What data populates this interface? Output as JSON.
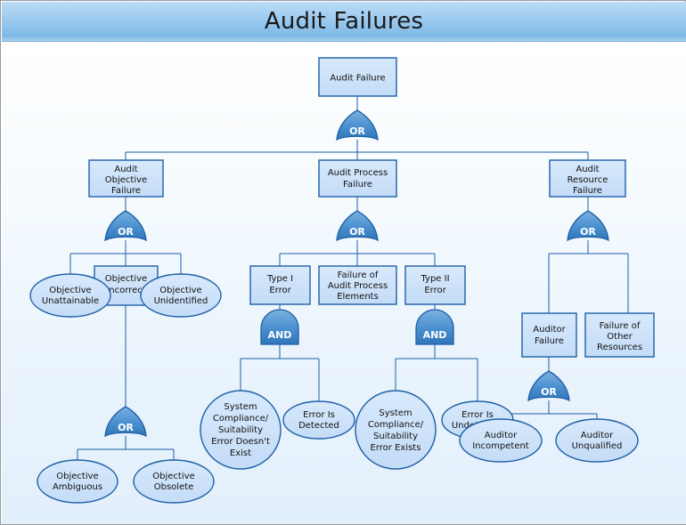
{
  "window": {
    "title": "Audit Failures"
  },
  "colors": {
    "title_bar_top": "#bcdcf6",
    "title_bar_bottom": "#7fb9e6",
    "canvas_top": "#ffffff",
    "canvas_bottom": "#e2f0fb",
    "node_fill": "#cfe4fa",
    "node_stroke": "#1f5fa8",
    "gate_fill_top": "#6fa9dd",
    "gate_fill_bottom": "#2f77b8",
    "gate_stroke": "#1f5fa8",
    "connector": "#1f5fa8",
    "text": "#111111",
    "gate_text": "#ffffff"
  },
  "diagram": {
    "type": "fault-tree",
    "nodes": [
      {
        "id": "audit-failure",
        "shape": "rect",
        "label": "Audit Failure",
        "lines": [
          "Audit Failure"
        ]
      },
      {
        "id": "audit-objective-failure",
        "shape": "rect",
        "label": "Audit Objective Failure",
        "lines": [
          "Audit",
          "Objective",
          "Failure"
        ]
      },
      {
        "id": "audit-process-failure",
        "shape": "rect",
        "label": "Audit Process Failure",
        "lines": [
          "Audit Process",
          "Failure"
        ]
      },
      {
        "id": "audit-resource-failure",
        "shape": "rect",
        "label": "Audit Resource Failure",
        "lines": [
          "Audit",
          "Resource",
          "Failure"
        ]
      },
      {
        "id": "objective-incorrect",
        "shape": "rect",
        "label": "Objective Incorrect",
        "lines": [
          "Objective",
          "Incorrect"
        ]
      },
      {
        "id": "objective-unattainable",
        "shape": "ellipse",
        "label": "Objective Unattainable",
        "lines": [
          "Objective",
          "Unattainable"
        ]
      },
      {
        "id": "objective-unidentified",
        "shape": "ellipse",
        "label": "Objective Unidentified",
        "lines": [
          "Objective",
          "Unidentified"
        ]
      },
      {
        "id": "objective-ambiguous",
        "shape": "ellipse",
        "label": "Objective Ambiguous",
        "lines": [
          "Objective",
          "Ambiguous"
        ]
      },
      {
        "id": "objective-obsolete",
        "shape": "ellipse",
        "label": "Objective Obsolete",
        "lines": [
          "Objective",
          "Obsolete"
        ]
      },
      {
        "id": "type-i-error",
        "shape": "rect",
        "label": "Type I Error",
        "lines": [
          "Type I",
          "Error"
        ]
      },
      {
        "id": "failure-of-audit-process-elements",
        "shape": "rect",
        "label": "Failure of Audit Process Elements",
        "lines": [
          "Failure of",
          "Audit Process",
          "Elements"
        ]
      },
      {
        "id": "type-ii-error",
        "shape": "rect",
        "label": "Type II Error",
        "lines": [
          "Type II",
          "Error"
        ]
      },
      {
        "id": "sys-compliance-error-doesnt-exist",
        "shape": "ellipse",
        "label": "System Compliance/ Suitability Error Doesn't Exist",
        "lines": [
          "System",
          "Compliance/",
          "Suitability",
          "Error Doesn't",
          "Exist"
        ]
      },
      {
        "id": "error-is-detected",
        "shape": "ellipse",
        "label": "Error Is Detected",
        "lines": [
          "Error Is",
          "Detected"
        ]
      },
      {
        "id": "sys-compliance-error-exists",
        "shape": "ellipse",
        "label": "System Compliance/ Suitability Error Exists",
        "lines": [
          "System",
          "Compliance/",
          "Suitability",
          "Error Exists"
        ]
      },
      {
        "id": "error-is-undetected",
        "shape": "ellipse",
        "label": "Error Is Undetected",
        "lines": [
          "Error Is",
          "Undetected"
        ]
      },
      {
        "id": "auditor-failure",
        "shape": "rect",
        "label": "Auditor Failure",
        "lines": [
          "Auditor",
          "Failure"
        ]
      },
      {
        "id": "failure-of-other-resources",
        "shape": "rect",
        "label": "Failure of Other Resources",
        "lines": [
          "Failure of",
          "Other",
          "Resources"
        ]
      },
      {
        "id": "auditor-incompetent",
        "shape": "ellipse",
        "label": "Auditor Incompetent",
        "lines": [
          "Auditor",
          "Incompetent"
        ]
      },
      {
        "id": "auditor-unqualified",
        "shape": "ellipse",
        "label": "Auditor Unqualified",
        "lines": [
          "Auditor",
          "Unqualified"
        ]
      }
    ],
    "gates": [
      {
        "id": "gate-top",
        "type": "OR",
        "label": "OR",
        "parent": "audit-failure"
      },
      {
        "id": "gate-objective",
        "type": "OR",
        "label": "OR",
        "parent": "audit-objective-failure"
      },
      {
        "id": "gate-process",
        "type": "OR",
        "label": "OR",
        "parent": "audit-process-failure"
      },
      {
        "id": "gate-resource",
        "type": "OR",
        "label": "OR",
        "parent": "audit-resource-failure"
      },
      {
        "id": "gate-objective-incorrect",
        "type": "OR",
        "label": "OR",
        "parent": "objective-incorrect"
      },
      {
        "id": "gate-type-i",
        "type": "AND",
        "label": "AND",
        "parent": "type-i-error"
      },
      {
        "id": "gate-type-ii",
        "type": "AND",
        "label": "AND",
        "parent": "type-ii-error"
      },
      {
        "id": "gate-auditor",
        "type": "OR",
        "label": "OR",
        "parent": "auditor-failure"
      }
    ]
  }
}
